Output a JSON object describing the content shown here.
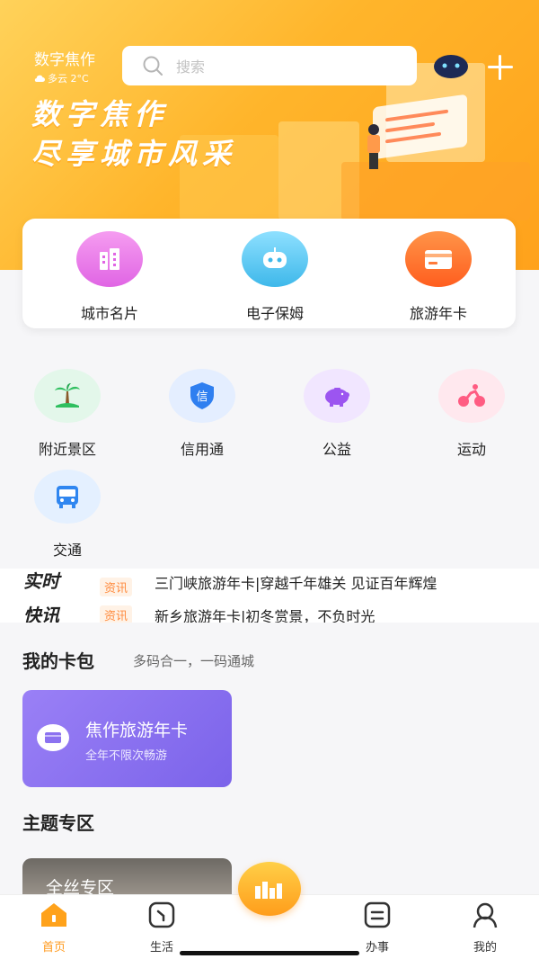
{
  "header": {
    "city": "数字焦作",
    "weather": "多云 2°C",
    "search_placeholder": "搜索",
    "slogan_line1": "数字焦作",
    "slogan_line2": "尽享城市风采"
  },
  "top_shortcuts": [
    {
      "label": "城市名片",
      "icon": "building-icon",
      "color": "#e86ce8"
    },
    {
      "label": "电子保姆",
      "icon": "robot-icon",
      "color": "#4fc3ef"
    },
    {
      "label": "旅游年卡",
      "icon": "card-icon",
      "color": "#ff6a2c"
    }
  ],
  "services": [
    {
      "label": "附近景区",
      "icon": "palm-tree-icon",
      "bg": "#e3f7ea"
    },
    {
      "label": "信用通",
      "icon": "shield-icon",
      "glyph": "信",
      "bg": "#e4eeff"
    },
    {
      "label": "公益",
      "icon": "piggy-bank-icon",
      "bg": "#f1e6ff"
    },
    {
      "label": "运动",
      "icon": "cycling-icon",
      "bg": "#ffe8ee"
    },
    {
      "label": "交通",
      "icon": "bus-icon",
      "bg": "#e4f0ff"
    }
  ],
  "news": {
    "logo_line1": "实时",
    "logo_line2": "快讯",
    "tag1": "资讯",
    "tag2": "资讯",
    "line1": "三门峡旅游年卡|穿越千年雄关 见证百年辉煌",
    "line2": "新乡旅游年卡|初冬赏景，不负时光"
  },
  "wallet": {
    "title": "我的卡包",
    "subtitle": "多码合一，一码通城",
    "card_title": "焦作旅游年卡",
    "card_subtitle": "全年不限次畅游"
  },
  "theme": {
    "title": "主题专区",
    "card_label": "全丝专区"
  },
  "tabbar": {
    "home": "首页",
    "life": "生活",
    "office": "办事",
    "mine": "我的"
  },
  "colors": {
    "accent": "#ff9a1e",
    "card_purple": "#8b72f0"
  }
}
